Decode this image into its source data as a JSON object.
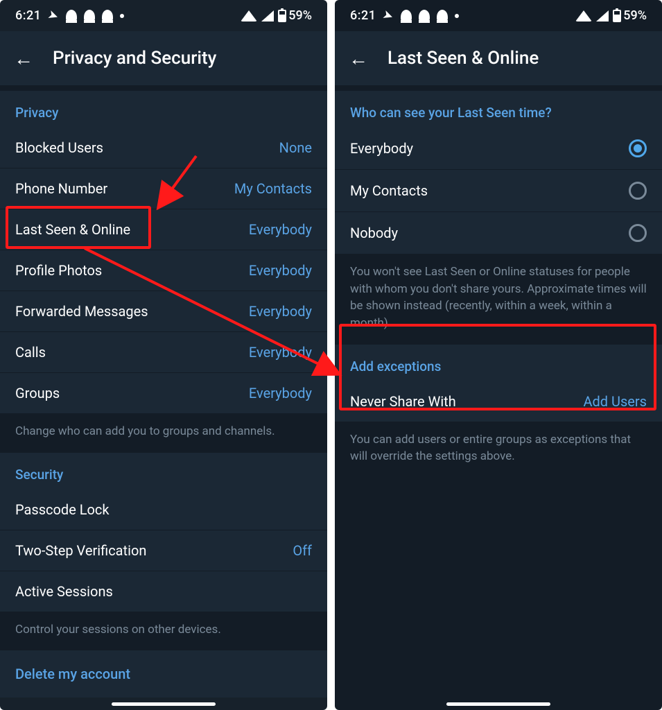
{
  "statusbar": {
    "time": "6:21",
    "battery": "59%"
  },
  "left": {
    "header_title": "Privacy and Security",
    "privacy_header": "Privacy",
    "items": [
      {
        "label": "Blocked Users",
        "value": "None"
      },
      {
        "label": "Phone Number",
        "value": "My Contacts"
      },
      {
        "label": "Last Seen & Online",
        "value": "Everybody"
      },
      {
        "label": "Profile Photos",
        "value": "Everybody"
      },
      {
        "label": "Forwarded Messages",
        "value": "Everybody"
      },
      {
        "label": "Calls",
        "value": "Everybody"
      },
      {
        "label": "Groups",
        "value": "Everybody"
      }
    ],
    "groups_note": "Change who can add you to groups and channels.",
    "security_header": "Security",
    "security_items": [
      {
        "label": "Passcode Lock",
        "value": ""
      },
      {
        "label": "Two-Step Verification",
        "value": "Off"
      },
      {
        "label": "Active Sessions",
        "value": ""
      }
    ],
    "sessions_note": "Control your sessions on other devices.",
    "delete_label": "Delete my account"
  },
  "right": {
    "header_title": "Last Seen & Online",
    "who_header": "Who can see your Last Seen time?",
    "options": [
      {
        "label": "Everybody",
        "selected": true
      },
      {
        "label": "My Contacts",
        "selected": false
      },
      {
        "label": "Nobody",
        "selected": false
      }
    ],
    "who_note": "You won't see Last Seen or Online statuses for people with whom you don't share yours. Approximate times will be shown instead (recently, within a week, within a month).",
    "exceptions_header": "Add exceptions",
    "never_share_label": "Never Share With",
    "never_share_value": "Add Users",
    "exceptions_note": "You can add users or entire groups as exceptions that will override the settings above."
  }
}
